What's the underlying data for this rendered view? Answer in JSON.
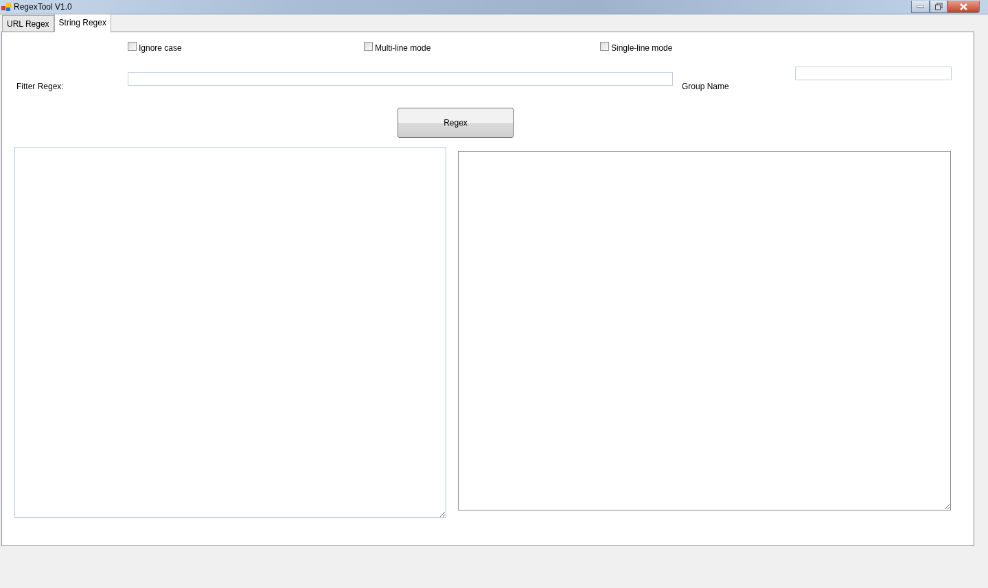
{
  "window": {
    "title": "RegexTool V1.0"
  },
  "tabs": [
    {
      "label": "URL Regex",
      "selected": false
    },
    {
      "label": "String Regex",
      "selected": true
    }
  ],
  "options": [
    {
      "label": "Ignore case",
      "checked": false
    },
    {
      "label": "Multi-line mode",
      "checked": false
    },
    {
      "label": "Single-line mode",
      "checked": false
    }
  ],
  "filter_regex": {
    "label": "Fitter Regex:"
  },
  "group_name": {
    "label": "Group Name"
  },
  "regex_button": {
    "label": "Regex"
  }
}
